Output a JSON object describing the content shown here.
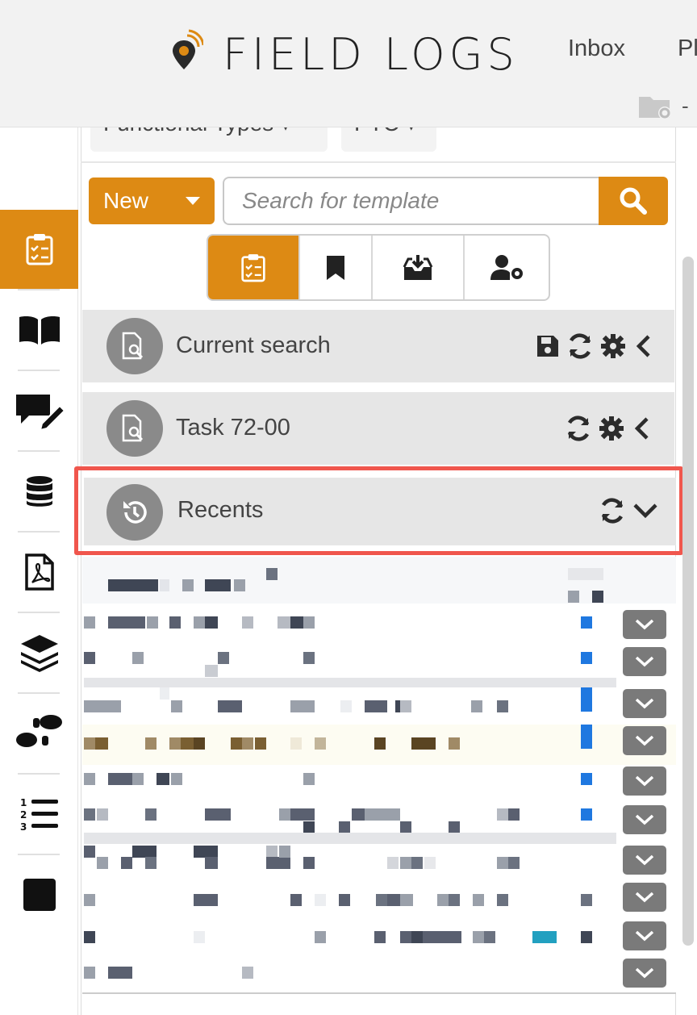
{
  "app": {
    "brand": "FIELD LOGS",
    "nav": {
      "inbox": "Inbox",
      "more": "Pl"
    },
    "header_right_dash": "-"
  },
  "filters": {
    "chips": [
      {
        "label": "Functional Types ▾"
      },
      {
        "label": "PTC ▾"
      }
    ]
  },
  "toolbar": {
    "new_label": "New",
    "search": {
      "placeholder": "Search for template",
      "value": ""
    }
  },
  "view_toggle": {
    "items": [
      {
        "name": "checklist-icon",
        "active": true
      },
      {
        "name": "bookmark-icon",
        "active": false
      },
      {
        "name": "inbox-download-icon",
        "active": false
      },
      {
        "name": "user-gear-icon",
        "active": false
      }
    ]
  },
  "sections": [
    {
      "label": "Current search",
      "tools": [
        "save-icon",
        "refresh-icon",
        "gear-icon",
        "chevron-left-icon"
      ]
    },
    {
      "label": "Task 72-00",
      "tools": [
        "refresh-icon",
        "gear-icon",
        "chevron-left-icon"
      ]
    },
    {
      "label": "Recents",
      "tools": [
        "refresh-icon",
        "chevron-down-icon"
      ]
    }
  ],
  "sidebar": {
    "items": [
      {
        "name": "checklist-icon",
        "active": true
      },
      {
        "name": "book-icon",
        "active": false
      },
      {
        "name": "comment-edit-icon",
        "active": false
      },
      {
        "name": "database-icon",
        "active": false
      },
      {
        "name": "pdf-file-icon",
        "active": false
      },
      {
        "name": "layers-icon",
        "active": false
      },
      {
        "name": "footprints-icon",
        "active": false
      },
      {
        "name": "ordered-list-icon",
        "active": false
      },
      {
        "name": "square-icon",
        "active": false
      }
    ]
  },
  "colors": {
    "accent": "#dd8a14",
    "highlight_border": "#f0564d",
    "section_bg": "#e6e6e6",
    "icon_circle": "#8a8a8a"
  }
}
